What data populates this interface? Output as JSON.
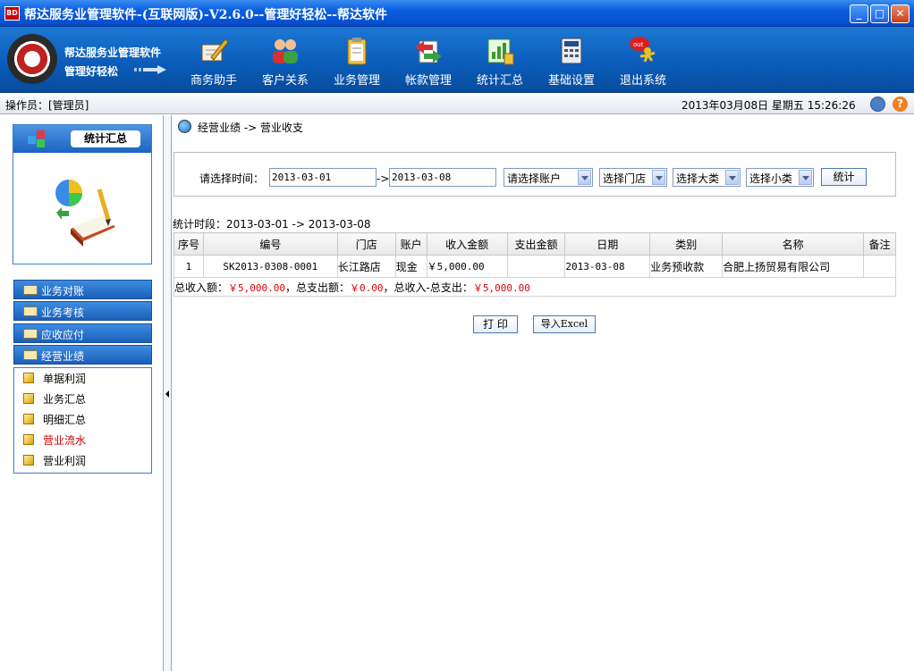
{
  "window": {
    "title": "帮达服务业管理软件-(互联网版)-V2.6.0--管理好轻松--帮达软件",
    "app_icon_text": "BD",
    "controls": {
      "minimize": "_",
      "maximize": "□",
      "close": "✕"
    }
  },
  "logo": {
    "name": "帮达服务业管理软件",
    "slogan": "管理好轻松"
  },
  "toolbar": {
    "items": [
      {
        "label": "商务助手",
        "icon": "pen-note-icon"
      },
      {
        "label": "客户关系",
        "icon": "people-icon"
      },
      {
        "label": "业务管理",
        "icon": "clipboard-icon"
      },
      {
        "label": "帐款管理",
        "icon": "exchange-icon"
      },
      {
        "label": "统计汇总",
        "icon": "chart-icon"
      },
      {
        "label": "基础设置",
        "icon": "calculator-icon"
      },
      {
        "label": "退出系统",
        "icon": "exit-runner-icon"
      }
    ]
  },
  "operator_bar": {
    "operator": "操作员：[管理员]",
    "datetime": "2013年03月08日  星期五  15:26:26"
  },
  "sidebar": {
    "section_title": "统计汇总",
    "nav": [
      {
        "label": "业务对账"
      },
      {
        "label": "业务考核"
      },
      {
        "label": "应收应付"
      },
      {
        "label": "经营业绩"
      }
    ],
    "subitems": [
      {
        "label": "单据利润",
        "active": false
      },
      {
        "label": "业务汇总",
        "active": false
      },
      {
        "label": "明细汇总",
        "active": false
      },
      {
        "label": "营业流水",
        "active": true
      },
      {
        "label": "营业利润",
        "active": false
      }
    ]
  },
  "main": {
    "breadcrumb": "经营业绩 -> 营业收支",
    "filter": {
      "label": "请选择时间：",
      "date_from": "2013-03-01",
      "arrow": "->",
      "date_to": "2013-03-08",
      "account": "请选择账户",
      "store": "选择门店",
      "major": "选择大类",
      "minor": "选择小类",
      "submit": "统计"
    },
    "period": "统计时段：2013-03-01 -> 2013-03-08",
    "table": {
      "headers": [
        "序号",
        "编号",
        "门店",
        "账户",
        "收入金额",
        "支出金额",
        "日期",
        "类别",
        "名称",
        "备注"
      ],
      "rows": [
        [
          "1",
          "SK2013-0308-0001",
          "长江路店",
          "现金",
          "￥5,000.00",
          "",
          "2013-03-08",
          "业务预收款",
          "合肥上扬贸易有限公司",
          ""
        ]
      ]
    },
    "totals": {
      "income_label": "总收入额：",
      "income": "￥5,000.00",
      "expense_label": "，总支出额：",
      "expense": "￥0.00",
      "net_label": "，总收入-总支出：",
      "net": "￥5,000.00"
    },
    "buttons": {
      "print": "打 印",
      "excel": "导入Excel"
    }
  }
}
